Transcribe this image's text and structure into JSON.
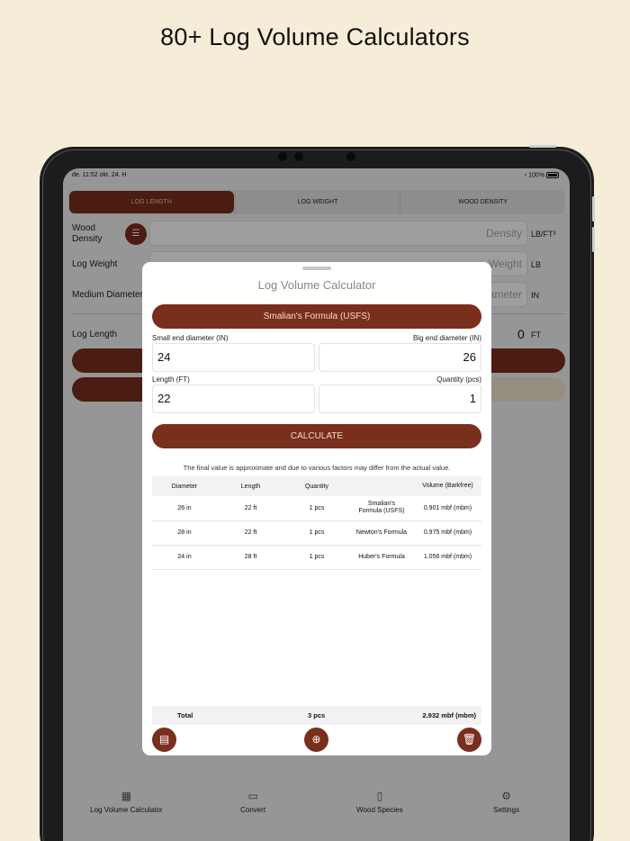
{
  "headline": "80+ Log Volume Calculators",
  "status": {
    "time_date": "de. 11:52  okt. 24. H",
    "battery": "100%"
  },
  "segments": [
    "LOG LENGTH",
    "LOG WEIGHT",
    "WOOD DENSITY"
  ],
  "background_form": {
    "wood_density_label": "Wood Density",
    "density_placeholder": "Density",
    "density_unit": "LB/FT³",
    "log_weight_label": "Log Weight",
    "weight_placeholder": "Weight",
    "weight_unit": "LB",
    "medium_diameter_label": "Medium Diameter",
    "diameter_placeholder": "ameter",
    "diameter_unit": "IN",
    "log_length_label": "Log Length",
    "log_length_value": "0",
    "log_length_unit": "FT"
  },
  "tabbar": [
    {
      "label": "Log Volume Calculator",
      "icon": "grid-icon"
    },
    {
      "label": "Convert",
      "icon": "convert-icon"
    },
    {
      "label": "Wood Species",
      "icon": "book-icon"
    },
    {
      "label": "Settings",
      "icon": "gear-icon"
    }
  ],
  "sheet": {
    "title": "Log Volume Calculator",
    "formula_button": "Smalian's Formula (USFS)",
    "small_end_label": "Small end diameter (IN)",
    "big_end_label": "Big end diameter (IN)",
    "small_end_value": "24",
    "big_end_value": "26",
    "length_label": "Length (FT)",
    "quantity_label": "Quantity (pcs)",
    "length_value": "22",
    "quantity_value": "1",
    "calculate_label": "CALCULATE",
    "note": "The final value is approximate and due to various factors may differ from the actual value.",
    "table": {
      "headers": [
        "Diameter",
        "Length",
        "Quantity",
        "",
        "Volume (Barkfree)"
      ],
      "rows": [
        [
          "26 in",
          "22 ft",
          "1 pcs",
          "Smalian's Formula (USFS)",
          "0.901 mbf (mbm)"
        ],
        [
          "28 in",
          "22 ft",
          "1 pcs",
          "Newton's Formula",
          "0.975 mbf (mbm)"
        ],
        [
          "24 in",
          "28 ft",
          "1 pcs",
          "Huber's Formula",
          "1.056 mbf (mbm)"
        ]
      ]
    },
    "total": {
      "label": "Total",
      "quantity": "3 pcs",
      "volume": "2.932 mbf (mbm)"
    }
  },
  "colors": {
    "accent": "#7a2e1c",
    "background": "#f6edd8"
  }
}
